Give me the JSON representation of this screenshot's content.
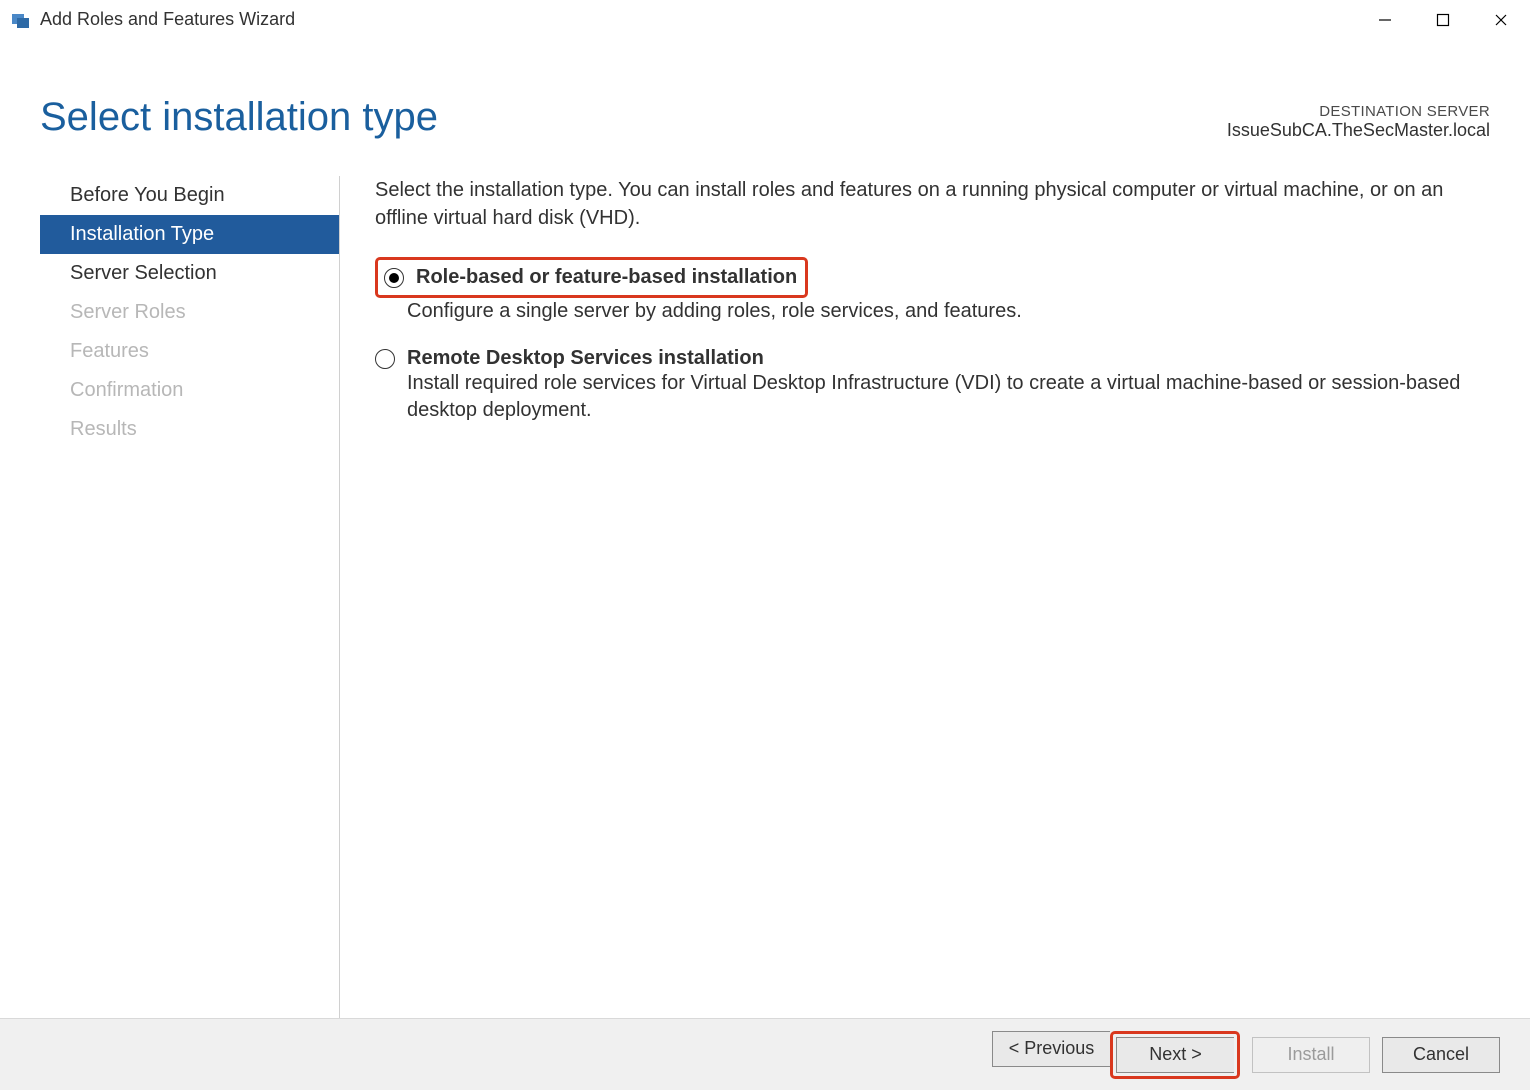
{
  "window": {
    "title": "Add Roles and Features Wizard"
  },
  "header": {
    "page_title": "Select installation type",
    "destination_label": "DESTINATION SERVER",
    "destination_server": "IssueSubCA.TheSecMaster.local"
  },
  "sidebar": {
    "steps": [
      {
        "label": "Before You Begin",
        "state": "enabled"
      },
      {
        "label": "Installation Type",
        "state": "active"
      },
      {
        "label": "Server Selection",
        "state": "enabled"
      },
      {
        "label": "Server Roles",
        "state": "disabled"
      },
      {
        "label": "Features",
        "state": "disabled"
      },
      {
        "label": "Confirmation",
        "state": "disabled"
      },
      {
        "label": "Results",
        "state": "disabled"
      }
    ]
  },
  "main": {
    "intro": "Select the installation type. You can install roles and features on a running physical computer or virtual machine, or on an offline virtual hard disk (VHD).",
    "options": [
      {
        "title": "Role-based or feature-based installation",
        "description": "Configure a single server by adding roles, role services, and features.",
        "selected": true,
        "highlighted": true
      },
      {
        "title": "Remote Desktop Services installation",
        "description": "Install required role services for Virtual Desktop Infrastructure (VDI) to create a virtual machine-based or session-based desktop deployment.",
        "selected": false,
        "highlighted": false
      }
    ]
  },
  "footer": {
    "previous": "< Previous",
    "next": "Next >",
    "install": "Install",
    "cancel": "Cancel"
  }
}
